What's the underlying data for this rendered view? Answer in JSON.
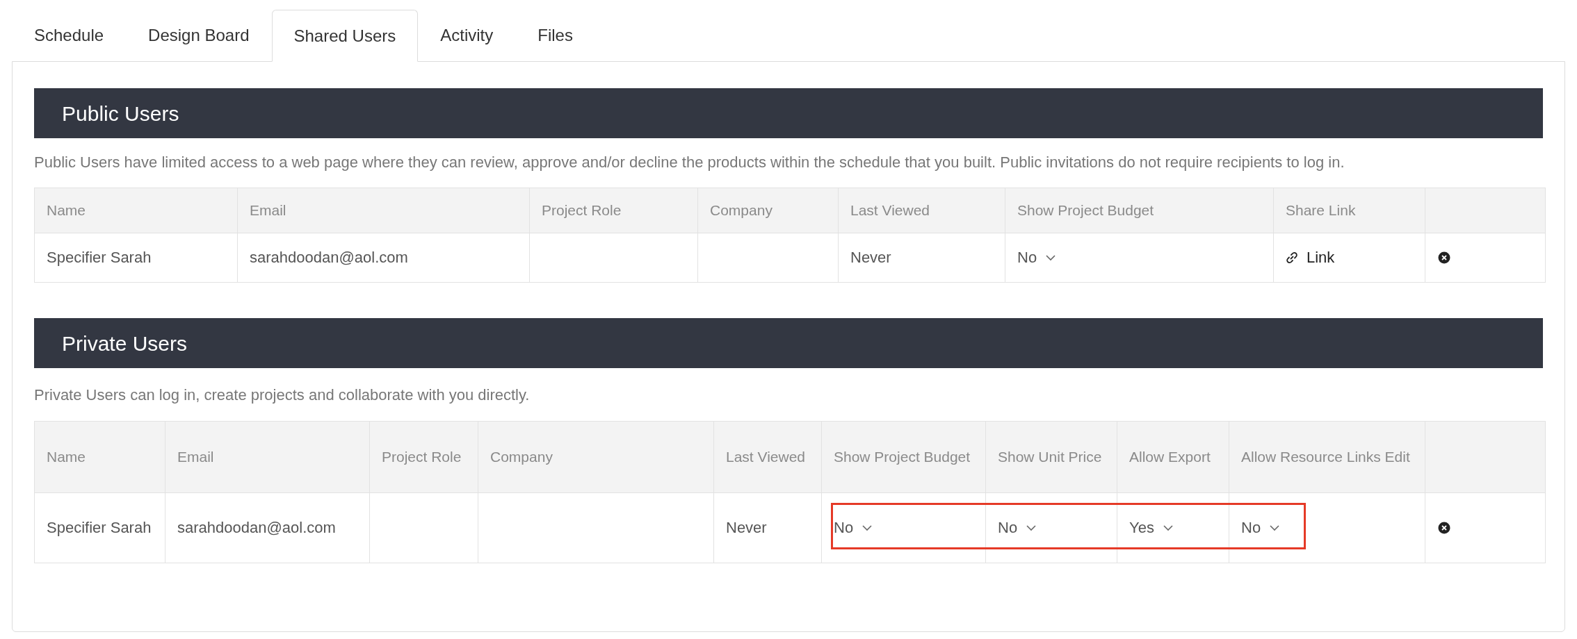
{
  "tabs": [
    {
      "label": "Schedule",
      "selected": false
    },
    {
      "label": "Design Board",
      "selected": false
    },
    {
      "label": "Shared Users",
      "selected": true
    },
    {
      "label": "Activity",
      "selected": false
    },
    {
      "label": "Files",
      "selected": false
    }
  ],
  "public_users": {
    "title": "Public Users",
    "description": "Public Users have limited access to a web page where they can review, approve and/or decline the products within the schedule that you built. Public invitations do not require recipients to log in.",
    "columns": [
      "Name",
      "Email",
      "Project Role",
      "Company",
      "Last Viewed",
      "Show Project Budget",
      "Share Link",
      ""
    ],
    "rows": [
      {
        "name": "Specifier Sarah",
        "email": "sarahdoodan@aol.com",
        "project_role": "",
        "company": "",
        "last_viewed": "Never",
        "show_project_budget": "No",
        "share_link": "Link"
      }
    ]
  },
  "private_users": {
    "title": "Private Users",
    "description": "Private Users can log in, create projects and collaborate with you directly.",
    "columns": [
      "Name",
      "Email",
      "Project Role",
      "Company",
      "Last Viewed",
      "Show Project Budget",
      "Show Unit Price",
      "Allow Export",
      "Allow Resource Links Edit",
      ""
    ],
    "rows": [
      {
        "name": "Specifier Sarah",
        "email": "sarahdoodan@aol.com",
        "last_viewed": "Never",
        "selects": [
          "No",
          "No",
          "Yes",
          "No"
        ],
        "highlighted": true
      }
    ]
  }
}
